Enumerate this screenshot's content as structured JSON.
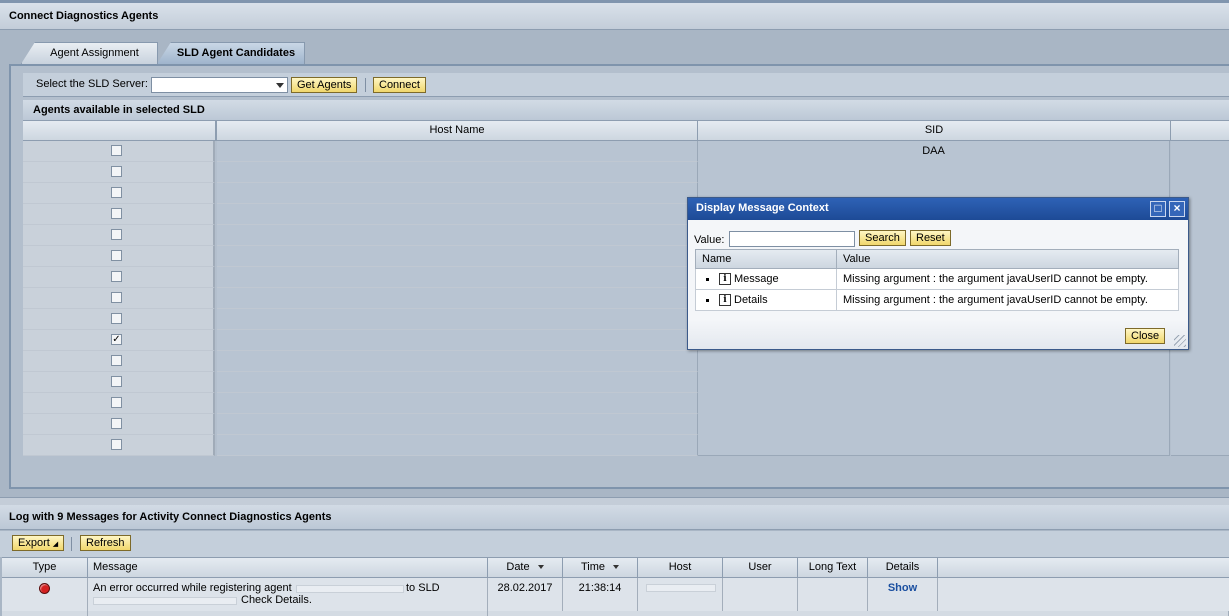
{
  "header": {
    "title": "Connect Diagnostics Agents"
  },
  "tabs": [
    {
      "label": "Agent Assignment",
      "active": false
    },
    {
      "label": "SLD Agent Candidates",
      "active": true
    }
  ],
  "sld_toolbar": {
    "server_label": "Select the SLD Server:",
    "server_value": "",
    "get_agents_label": "Get Agents",
    "connect_label": "Connect"
  },
  "agents_table": {
    "caption": "Agents available in selected SLD",
    "columns": [
      "",
      "Host Name",
      "SID"
    ],
    "sid_value": "DAA",
    "rows": [
      {
        "checked": false
      },
      {
        "checked": false
      },
      {
        "checked": false
      },
      {
        "checked": false
      },
      {
        "checked": false
      },
      {
        "checked": false
      },
      {
        "checked": false
      },
      {
        "checked": false
      },
      {
        "checked": false
      },
      {
        "checked": true
      },
      {
        "checked": false
      },
      {
        "checked": false
      },
      {
        "checked": false
      },
      {
        "checked": false
      },
      {
        "checked": false
      }
    ]
  },
  "log": {
    "title": "Log with 9 Messages for Activity Connect Diagnostics Agents",
    "export_label": "Export",
    "refresh_label": "Refresh",
    "columns": [
      "Type",
      "Message",
      "Date",
      "Time",
      "Host",
      "User",
      "Long Text",
      "Details"
    ],
    "rows": [
      {
        "status_color": "#d42020",
        "message_part1": "An error occurred while registering agent",
        "message_part2": "to SLD",
        "message_part3": "Check Details.",
        "date": "28.02.2017",
        "time": "21:38:14",
        "details": "Show"
      }
    ]
  },
  "dialog": {
    "title": "Display Message Context",
    "value_label": "Value:",
    "value_input": "",
    "search_label": "Search",
    "reset_label": "Reset",
    "col_name": "Name",
    "col_value": "Value",
    "rows": [
      {
        "name": "Message",
        "value": "Missing argument : the argument javaUserID cannot be empty."
      },
      {
        "name": "Details",
        "value": "Missing argument : the argument javaUserID cannot be empty."
      }
    ],
    "close_label": "Close",
    "maximize_glyph": "□",
    "close_glyph": "×",
    "info_glyph": "i"
  },
  "colors": {
    "accent_dialog": "#2e62b6",
    "button_yellow": "#f1d76c",
    "error_red": "#d42020",
    "link_blue": "#1a4fa0"
  }
}
